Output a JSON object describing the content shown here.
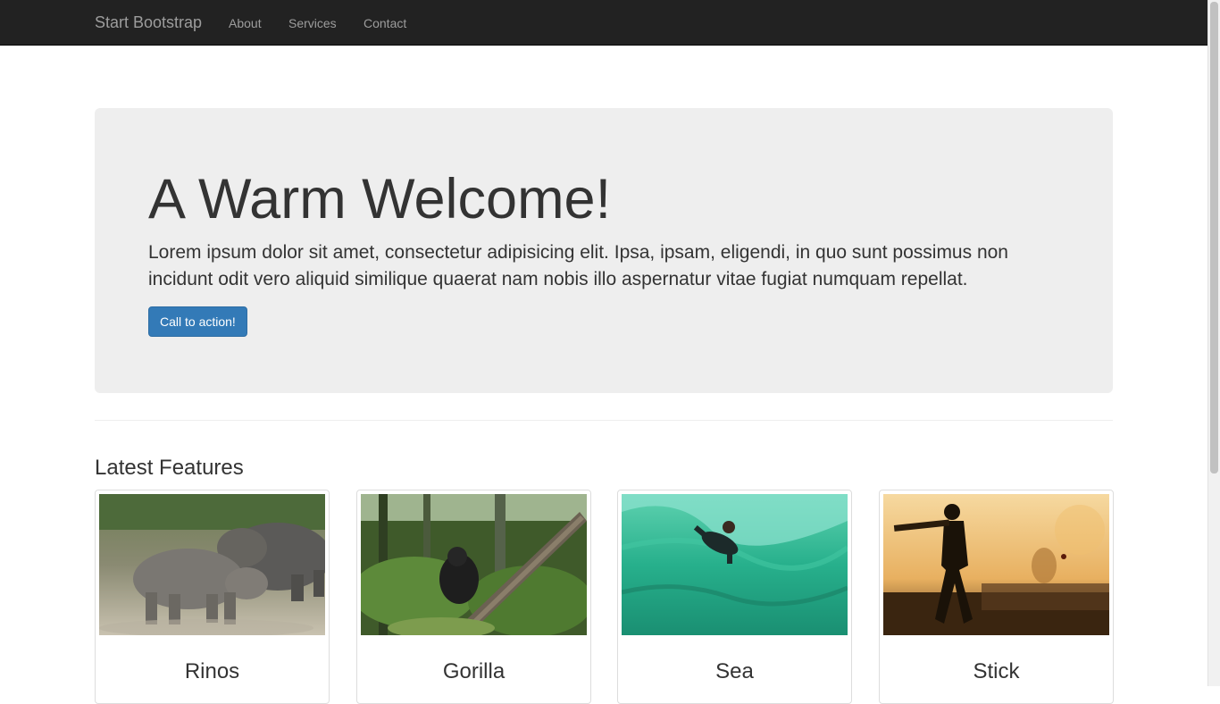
{
  "navbar": {
    "brand": "Start Bootstrap",
    "links": [
      "About",
      "Services",
      "Contact"
    ]
  },
  "hero": {
    "title": "A Warm Welcome!",
    "text": "Lorem ipsum dolor sit amet, consectetur adipisicing elit. Ipsa, ipsam, eligendi, in quo sunt possimus non incidunt odit vero aliquid similique quaerat nam nobis illo aspernatur vitae fugiat numquam repellat.",
    "button_label": "Call to action!"
  },
  "features": {
    "heading": "Latest Features",
    "cards": [
      {
        "caption": "Rinos",
        "image": "rhinos-photo"
      },
      {
        "caption": "Gorilla",
        "image": "gorilla-photo"
      },
      {
        "caption": "Sea",
        "image": "surfer-photo"
      },
      {
        "caption": "Stick",
        "image": "cricket-player-photo"
      }
    ]
  },
  "colors": {
    "navbar_bg": "#222222",
    "nav_text": "#9d9d9d",
    "jumbotron_bg": "#eeeeee",
    "primary": "#337ab7"
  }
}
